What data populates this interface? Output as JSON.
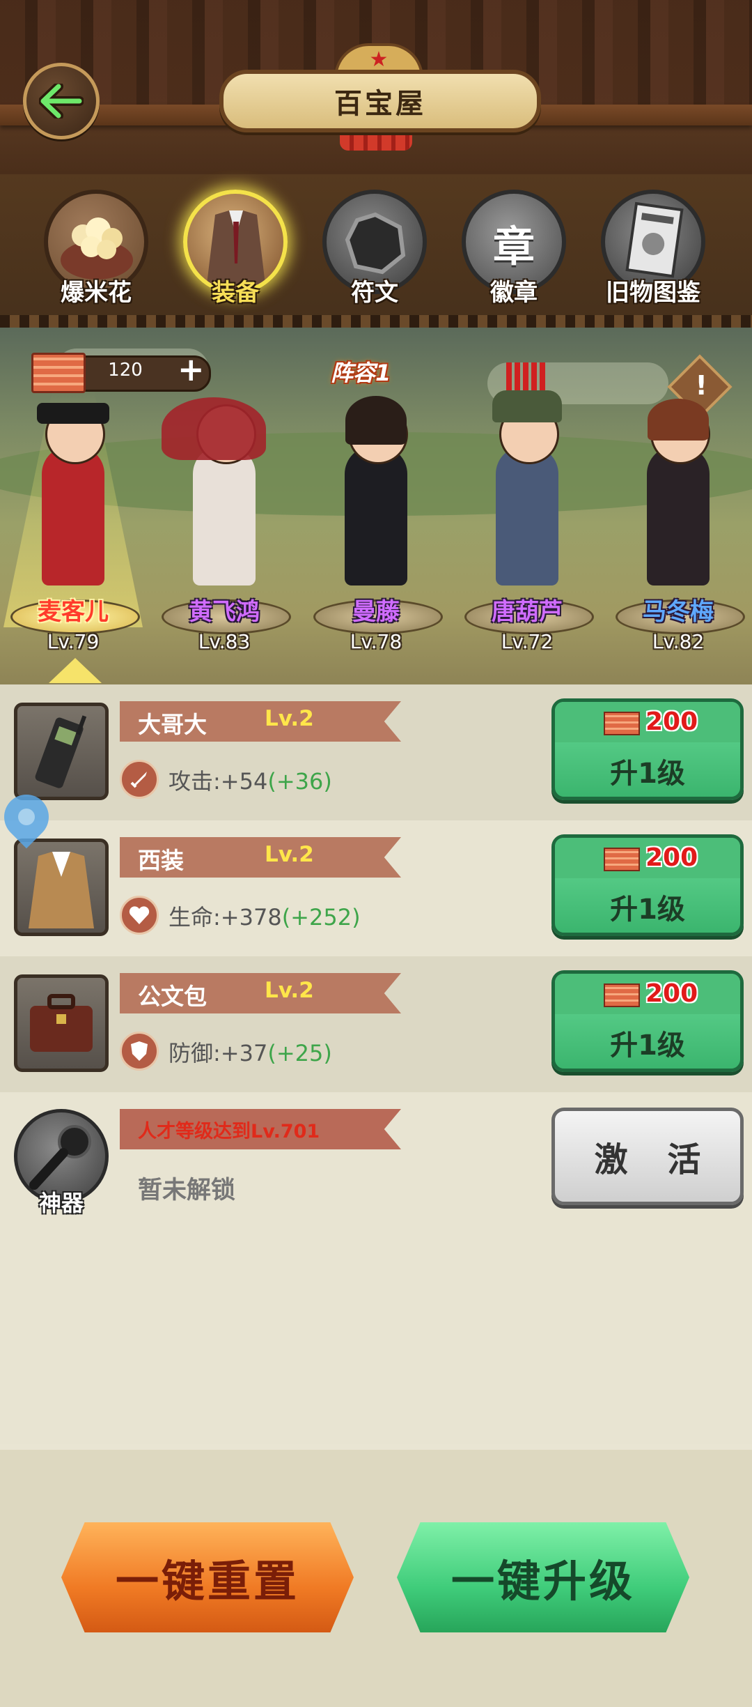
{
  "header": {
    "title": "百宝屋"
  },
  "tabs": [
    {
      "label": "爆米花",
      "active": false
    },
    {
      "label": "装备",
      "active": true
    },
    {
      "label": "符文",
      "active": false
    },
    {
      "label": "徽章",
      "active": false
    },
    {
      "label": "旧物图鉴",
      "active": false
    }
  ],
  "badge_icon_text": "章",
  "currency": {
    "amount": "120",
    "plus": "+"
  },
  "lineup": {
    "label": "阵容1",
    "info": "!"
  },
  "heroes": [
    {
      "name": "麦客儿",
      "level": "Lv.79",
      "selected": true
    },
    {
      "name": "黄飞鸿",
      "level": "Lv.83",
      "selected": false
    },
    {
      "name": "曼藤",
      "level": "Lv.78",
      "selected": false
    },
    {
      "name": "唐葫芦",
      "level": "Lv.72",
      "selected": false
    },
    {
      "name": "马冬梅",
      "level": "Lv.82",
      "selected": false
    }
  ],
  "equipment": [
    {
      "name": "大哥大",
      "level": "Lv.2",
      "stat": "攻击:+54",
      "bonus": "(+36)",
      "cost": "200",
      "button": "升1级",
      "icon": "sword-icon"
    },
    {
      "name": "西装",
      "level": "Lv.2",
      "stat": "生命:+378",
      "bonus": "(+252)",
      "cost": "200",
      "button": "升1级",
      "icon": "heart-icon"
    },
    {
      "name": "公文包",
      "level": "Lv.2",
      "stat": "防御:+37",
      "bonus": "(+25)",
      "cost": "200",
      "button": "升1级",
      "icon": "shield-icon"
    }
  ],
  "artifact": {
    "label": "神器",
    "requirement": "人才等级达到Lv.701",
    "status": "暂未解锁",
    "button": "激 活"
  },
  "bottom": {
    "reset": "一键重置",
    "upgrade_all": "一键升级"
  },
  "colors": {
    "upgrade_green": "#3bb56e",
    "reset_orange": "#f07a24",
    "cost_red": "#e11a1a",
    "bonus_green": "#3ea54a"
  }
}
